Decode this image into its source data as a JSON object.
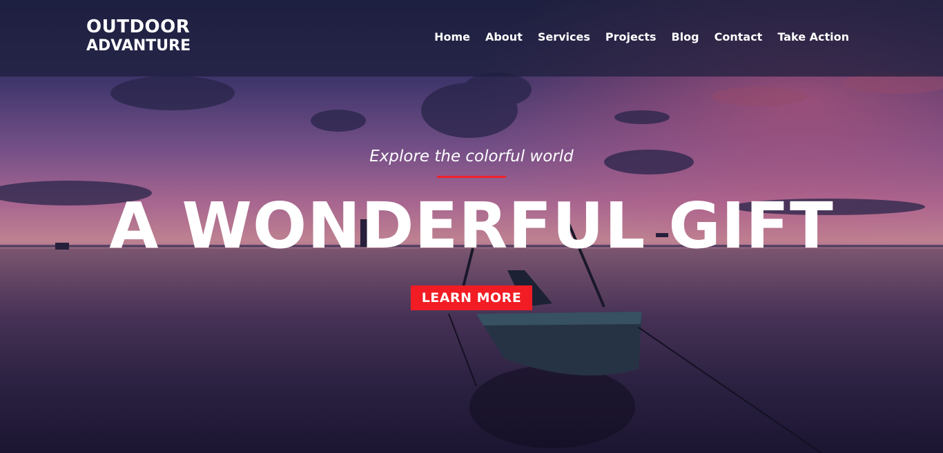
{
  "logo": {
    "line1": "OUTDOOR",
    "line2": "ADVANTURE"
  },
  "nav": {
    "items": [
      {
        "label": "Home"
      },
      {
        "label": "About"
      },
      {
        "label": "Services"
      },
      {
        "label": "Projects"
      },
      {
        "label": "Blog"
      },
      {
        "label": "Contact"
      },
      {
        "label": "Take Action"
      }
    ]
  },
  "hero": {
    "tagline": "Explore the colorful world",
    "headline": "A WONDERFUL GIFT",
    "cta_label": "LEARN MORE"
  },
  "colors": {
    "accent": "#f11c24",
    "header_bg": "#1c1e3c",
    "text": "#ffffff"
  }
}
